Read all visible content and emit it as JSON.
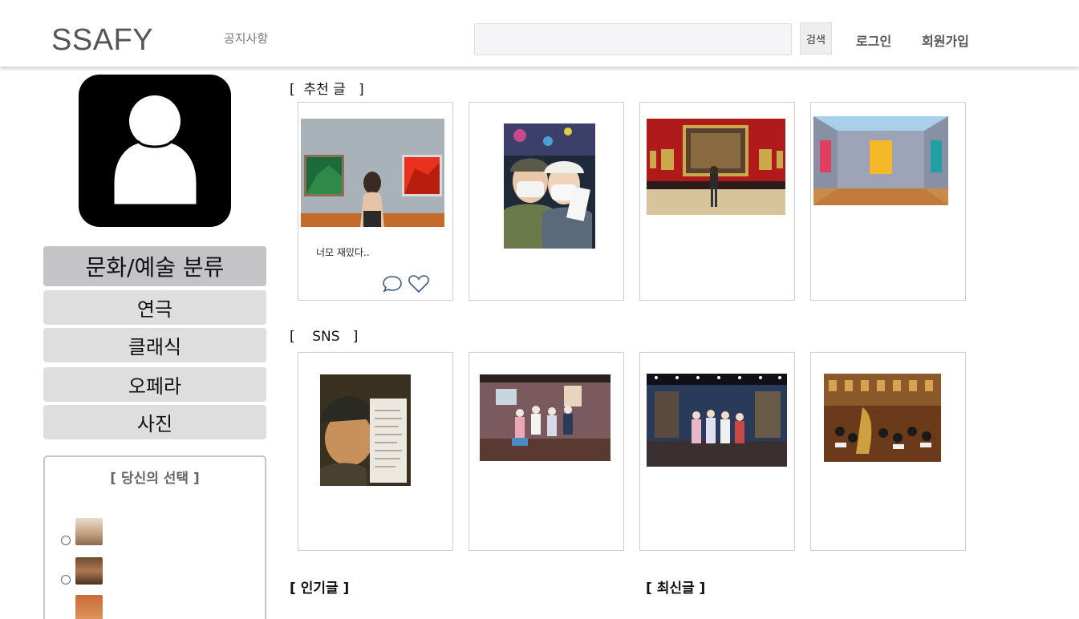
{
  "header": {
    "logo": "SSAFY",
    "notice_link": "공지사항",
    "search_placeholder": "",
    "search_button": "검색",
    "login": "로그인",
    "signup": "회원가입"
  },
  "sidebar": {
    "category_header": "문화/예술 분류",
    "categories": [
      "연극",
      "클래식",
      "오페라",
      "사진"
    ],
    "choice_title": "[ 당신의 선택 ]"
  },
  "sections": {
    "recommended": "[  추천 글   ]",
    "sns": "[    SNS   ]",
    "popular": "[ 인기글 ]",
    "latest": "[ 최신글 ]"
  },
  "recommended_cards": [
    {
      "caption": "너모 재밌다..",
      "image": "woman viewing paintings in gallery"
    },
    {
      "caption": "",
      "image": "two friends selfie at museum"
    },
    {
      "caption": "",
      "image": "visitor in red gallery with classical painting"
    },
    {
      "caption": "",
      "image": "modern gallery with yellow canvas"
    }
  ],
  "sns_cards": [
    {
      "image": "selfie holding receipt"
    },
    {
      "image": "theater cast on stage"
    },
    {
      "image": "musical cast on stage"
    },
    {
      "image": "orchestra in concert hall"
    }
  ],
  "colors": {
    "accent_icon": "#3a5a8a",
    "category_header_bg": "#c4c4c6",
    "category_bg": "#dedede"
  },
  "icons": [
    "comment-icon",
    "heart-icon",
    "person-icon"
  ]
}
